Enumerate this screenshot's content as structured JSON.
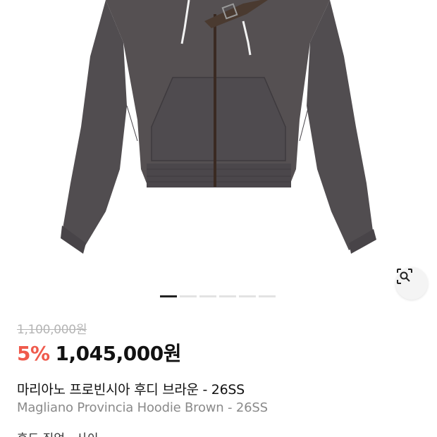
{
  "product": {
    "image": {
      "subject_icon": "hoodie-image",
      "garment_color": "#555052",
      "garment_shadow": "#48444a",
      "zipper_color": "#3a2a22",
      "drawstring_color": "#f2f2f2",
      "strap_color": "#4a3a30"
    },
    "lens_icon": "lens-search-icon",
    "pager": {
      "total": 6,
      "active_index": 0
    },
    "original_price": "1,100,000원",
    "discount_rate": "5%",
    "sale_price": "1,045,000원",
    "name_ko": "마리아노 프로빈시아 후디 브라운 - 26SS",
    "name_en": "Magliano Provincia Hoodie Brown - 26SS",
    "detail_partial": "후드 집업 · 사이"
  },
  "colors": {
    "discount": "#ef5a4c",
    "pager_active": "#222222",
    "pager_inactive": "#e3e3e3"
  }
}
